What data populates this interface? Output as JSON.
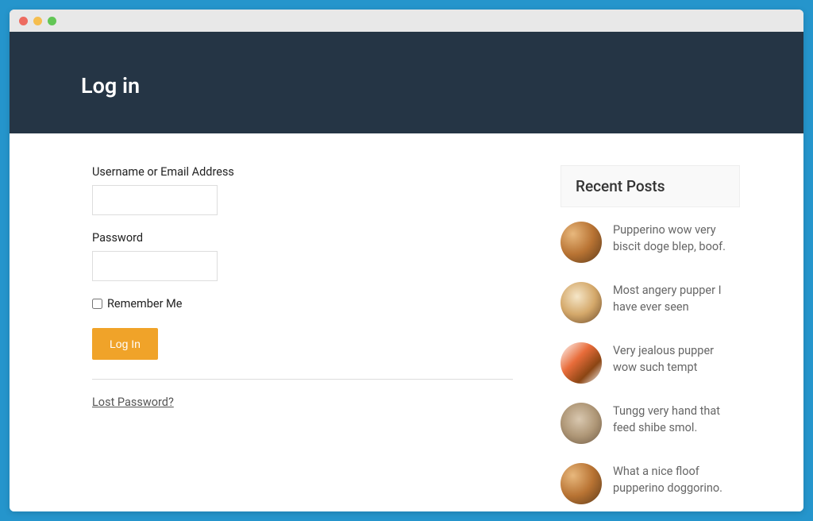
{
  "header": {
    "title": "Log in"
  },
  "form": {
    "username_label": "Username or Email Address",
    "password_label": "Password",
    "remember_label": "Remember Me",
    "submit_label": "Log In",
    "lost_password_label": "Lost Password?"
  },
  "sidebar": {
    "heading": "Recent Posts",
    "posts": [
      {
        "title": "Pupperino wow very biscit doge blep, boof."
      },
      {
        "title": "Most angery pupper I have ever seen"
      },
      {
        "title": "Very jealous pupper wow such tempt"
      },
      {
        "title": "Tungg very hand that feed shibe smol."
      },
      {
        "title": "What a nice floof pupperino doggorino."
      }
    ]
  }
}
